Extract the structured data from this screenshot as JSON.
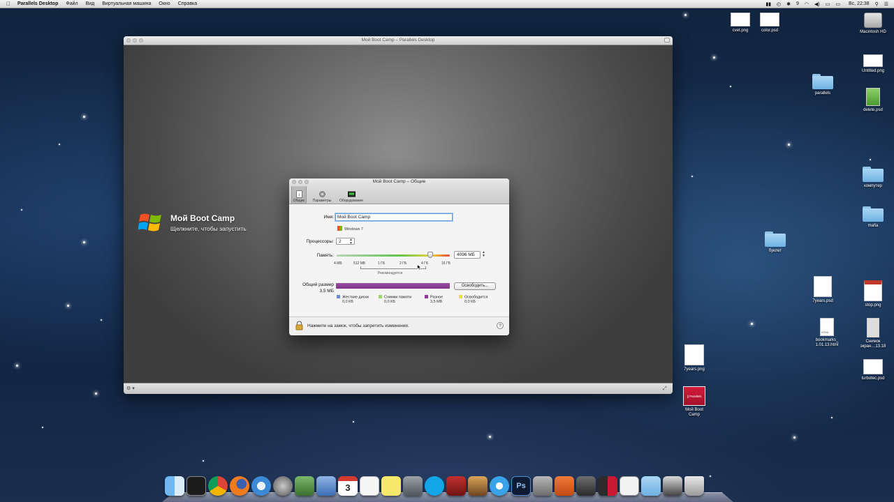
{
  "menubar": {
    "apple": "",
    "app": "Parallels Desktop",
    "items": [
      "Файл",
      "Вид",
      "Виртуальная машина",
      "Окно",
      "Справка"
    ],
    "right": {
      "status": "9",
      "day_time": "Вс, 22:38"
    }
  },
  "main_window": {
    "title": "Мой Boot Camp – Parallels Desktop",
    "vm": {
      "name": "Мой Boot Camp",
      "hint": "Щелкните, чтобы запустить"
    },
    "bottom_left": "⚙ ▾",
    "bottom_right": "⤢"
  },
  "dialog": {
    "title": "Мой Boot Camp – Общие",
    "tabs": [
      {
        "label": "Общие",
        "icon": "info-icon"
      },
      {
        "label": "Параметры",
        "icon": "gears-icon"
      },
      {
        "label": "Оборудование",
        "icon": "chip-icon"
      }
    ],
    "name_label": "Имя:",
    "name_value": "Мой Boot Camp",
    "os": "Windows 7",
    "cpu_label": "Процессоры:",
    "cpu_value": "2",
    "memory_label": "Память:",
    "memory_value": "4096 МБ",
    "memory_level": 0.83,
    "memory_ticks": [
      "4 МБ",
      "512 МБ",
      "1 ГБ",
      "2 ГБ",
      "4 ГБ",
      "16 ГБ"
    ],
    "recommended": "Рекомендуется",
    "size_label": "Общий размер",
    "size_value": "3,5 МБ",
    "free_button": "Освободить...",
    "legend": [
      {
        "name": "Жесткие диски",
        "value": "0,0 КБ",
        "color": "#6a8fd0"
      },
      {
        "name": "Снимки памяти",
        "value": "0,0 КБ",
        "color": "#9ed46b"
      },
      {
        "name": "Разное",
        "value": "3,5 МБ",
        "color": "#8c3d96"
      },
      {
        "name": "Освободится",
        "value": "0,0 КБ",
        "color": "#e6dc54"
      }
    ],
    "lock_text": "Нажмите на замок, чтобы запретить изменения.",
    "help": "?"
  },
  "desktop_icons": [
    {
      "label": "cvet.png"
    },
    {
      "label": "color.psd"
    },
    {
      "label": "Macintosh HD"
    },
    {
      "label": "Untitled.png"
    },
    {
      "label": "parallels"
    },
    {
      "label": "delete.psd"
    },
    {
      "label": "компутер"
    },
    {
      "label": "mafia"
    },
    {
      "label": "буклет"
    },
    {
      "label": "7years.psd"
    },
    {
      "label": "stop.png"
    },
    {
      "label": "bookmarks_\n1.01.13.html",
      "line1": "bookmarks_",
      "line2": "1.01.13.html",
      "badge": "HTML"
    },
    {
      "label": "Снимок\nэкран…13.18",
      "line1": "Снимок",
      "line2": "экран…13.18"
    },
    {
      "label": "turbotec.psd"
    },
    {
      "label": "7years.png"
    },
    {
      "label": "Мой Boot\nCamp",
      "line1": "Мой Boot",
      "line2": "Camp",
      "badge": "|| Parallels"
    }
  ],
  "dock": {
    "items": [
      "finder-icon",
      "activity-monitor-icon",
      "chrome-icon",
      "firefox-icon",
      "safari-icon",
      "launchpad-icon",
      "mail-icon",
      "preview-icon",
      "calendar-icon",
      "textedit-icon",
      "stickies-icon",
      "facetime-icon",
      "skype-icon",
      "photo-booth-icon",
      "iphoto-icon",
      "itunes-icon",
      "photoshop-icon",
      "system-prefs-icon",
      "keynote-icon",
      "quicktime-icon",
      "parallels-icon",
      "documents-icon",
      "folder-icon",
      "downloads-icon",
      "trash-icon"
    ],
    "calendar_day": "3",
    "ps_text": "Ps"
  },
  "colors": {
    "accent": "#6a9fd8",
    "size_bar": "#8c3d96"
  }
}
